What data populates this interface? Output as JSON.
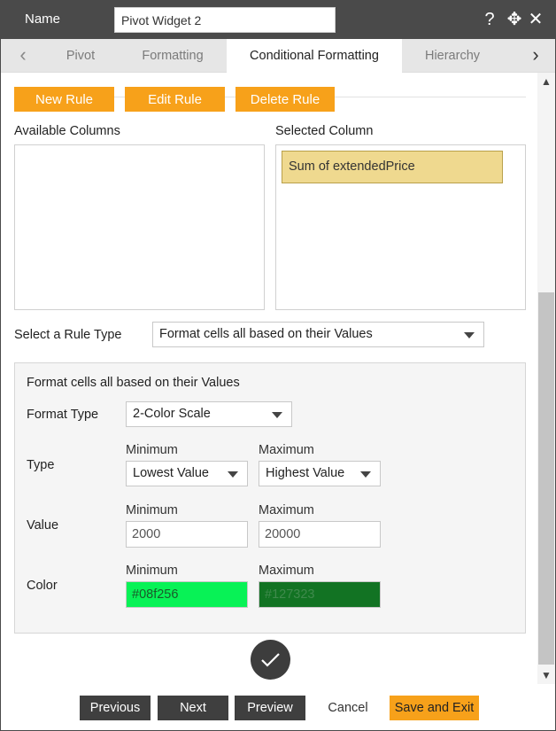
{
  "header": {
    "name_label": "Name",
    "name_value": "Pivot Widget 2",
    "help_icon": "?",
    "move_icon": "✥",
    "close_icon": "✕"
  },
  "tabs": {
    "prev_icon": "‹",
    "next_icon": "›",
    "items": [
      {
        "label": "Pivot",
        "active": false
      },
      {
        "label": "Formatting",
        "active": false
      },
      {
        "label": "Conditional Formatting",
        "active": true
      },
      {
        "label": "Hierarchy",
        "active": false
      }
    ]
  },
  "rules": {
    "new_rule": "New Rule",
    "edit_rule": "Edit Rule",
    "delete_rule": "Delete Rule"
  },
  "columns": {
    "available_label": "Available Columns",
    "selected_label": "Selected Column",
    "selected_items": [
      "Sum of extendedPrice"
    ]
  },
  "rule_type": {
    "label": "Select a Rule Type",
    "value": "Format cells all based on their Values"
  },
  "format_panel": {
    "title": "Format cells all based on their Values",
    "format_type_label": "Format Type",
    "format_type_value": "2-Color Scale",
    "type_label": "Type",
    "value_label": "Value",
    "color_label": "Color",
    "minimum_label": "Minimum",
    "maximum_label": "Maximum",
    "type_min": "Lowest Value",
    "type_max": "Highest Value",
    "value_min": "2000",
    "value_max": "20000",
    "color_min": "#08f256",
    "color_max": "#127323"
  },
  "footer": {
    "previous": "Previous",
    "next": "Next",
    "preview": "Preview",
    "cancel": "Cancel",
    "save_exit": "Save and Exit"
  },
  "colors": {
    "header_bg": "#4a4a4a",
    "accent_orange": "#f7a11a",
    "selected_item_bg": "#efd98f",
    "color_min_swatch": "#08f256",
    "color_max_swatch": "#127323"
  }
}
